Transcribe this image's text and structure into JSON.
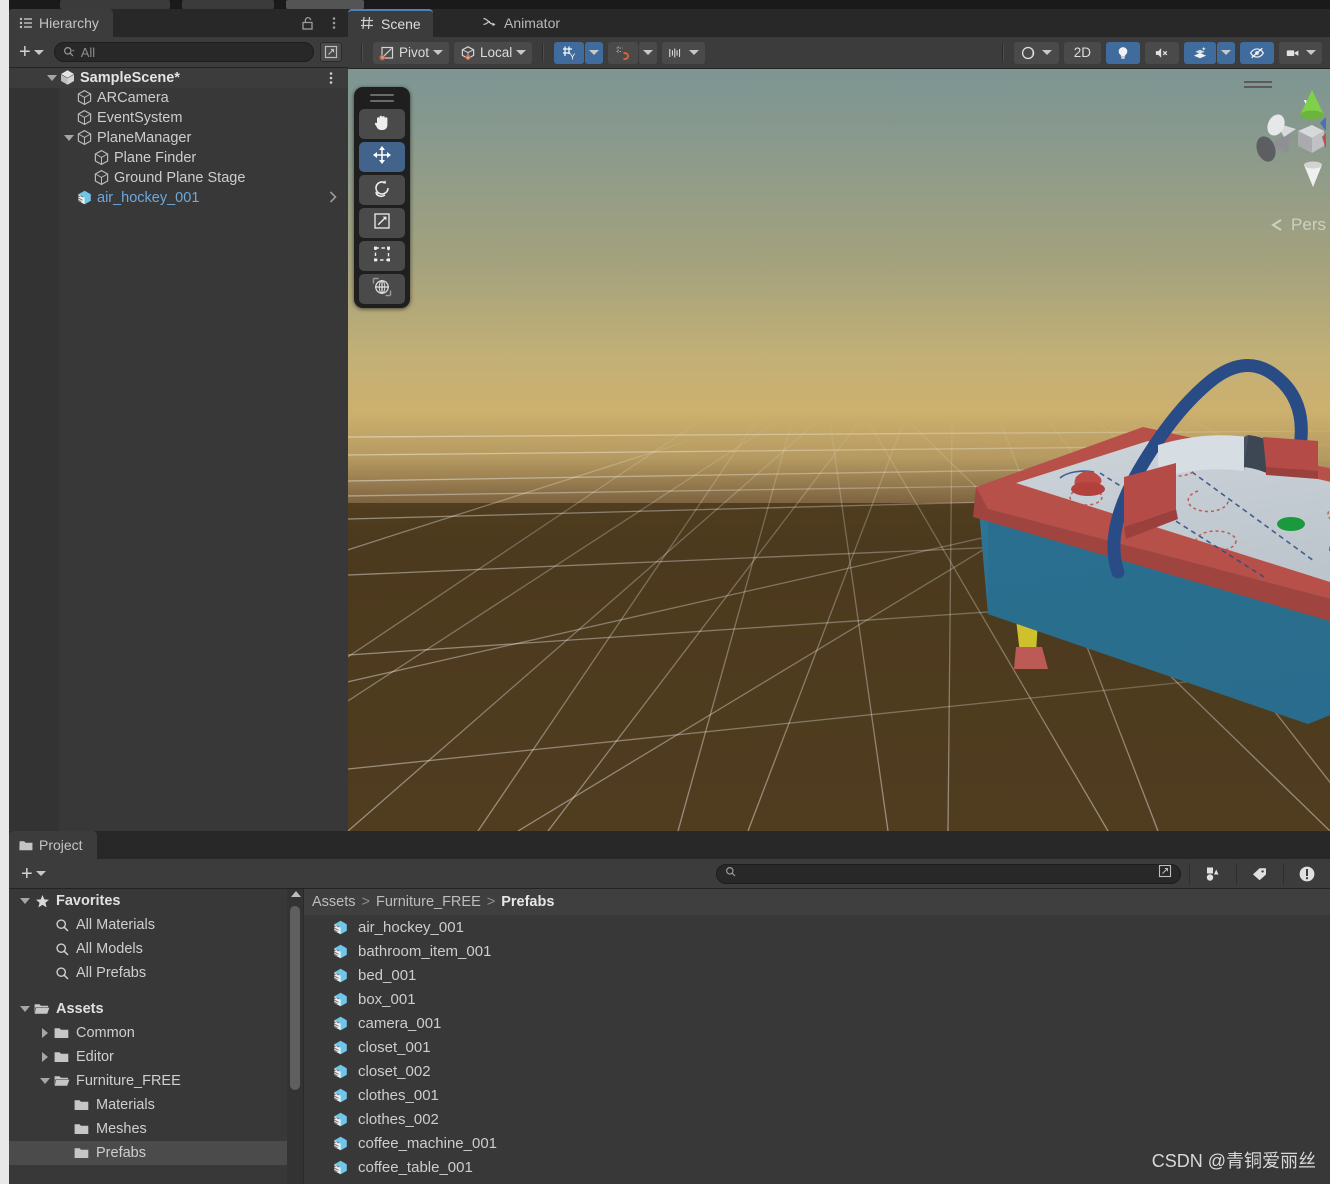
{
  "window": {
    "top_chips": [
      "",
      "",
      ""
    ]
  },
  "hierarchy": {
    "tab_label": "Hierarchy",
    "tab_icon": "hierarchy-list-icon",
    "lock_icon": "lock-open-icon",
    "menu_icon": "kebab-menu-icon",
    "add_label": "+",
    "search_placeholder": "All",
    "search_value": "",
    "search_icon": "search-icon",
    "expand_icon": "expand-window-icon",
    "rows": [
      {
        "label": "SampleScene*",
        "indent": 0,
        "icon": "unity-scene-icon",
        "expanded": true,
        "type": "scene",
        "kebab": true
      },
      {
        "label": "ARCamera",
        "indent": 1,
        "icon": "gameobject-cube-icon",
        "expanded": null,
        "type": "gameobject"
      },
      {
        "label": "EventSystem",
        "indent": 1,
        "icon": "gameobject-cube-icon",
        "expanded": null,
        "type": "gameobject"
      },
      {
        "label": "PlaneManager",
        "indent": 1,
        "icon": "gameobject-cube-icon",
        "expanded": true,
        "type": "gameobject"
      },
      {
        "label": "Plane Finder",
        "indent": 2,
        "icon": "gameobject-cube-icon",
        "expanded": null,
        "type": "gameobject"
      },
      {
        "label": "Ground Plane Stage",
        "indent": 2,
        "icon": "gameobject-cube-icon",
        "expanded": null,
        "type": "gameobject"
      },
      {
        "label": "air_hockey_001",
        "indent": 1,
        "icon": "prefab-icon",
        "expanded": null,
        "type": "prefab",
        "selected": true,
        "chevron": true
      }
    ]
  },
  "scene_panel": {
    "tabs": [
      {
        "label": "Scene",
        "icon": "scene-grid-icon",
        "active": true
      },
      {
        "label": "Animator",
        "icon": "animator-icon",
        "active": false
      }
    ],
    "toolbar": {
      "pivot_label": "Pivot",
      "pivot_icon": "pivot-icon",
      "handle_label": "Local",
      "handle_icon": "local-space-cube-icon",
      "grid_snap_icon": "grid-axis-y-icon",
      "grid_snap_on": true,
      "magnet_snap_icon": "magnet-snap-icon",
      "magnet_snap_on": false,
      "increment_snap_icon": "increment-snap-icon",
      "right": [
        {
          "name": "draw-mode-shaded-icon",
          "label": "",
          "on": false,
          "has_arrow": true
        },
        {
          "name": "2d-toggle",
          "label": "2D",
          "on": false,
          "has_arrow": false
        },
        {
          "name": "scene-lighting-icon",
          "label": "",
          "on": true,
          "has_arrow": false
        },
        {
          "name": "scene-audio-mute-icon",
          "label": "",
          "on": false,
          "has_arrow": false
        },
        {
          "name": "scene-fx-icon",
          "label": "",
          "on": true,
          "has_arrow": true
        },
        {
          "name": "scene-visibility-icon",
          "label": "",
          "on": true,
          "has_arrow": false
        },
        {
          "name": "scene-camera-icon",
          "label": "",
          "on": false,
          "has_arrow": true
        }
      ]
    },
    "tools_overlay": {
      "grip": "drag-handle",
      "buttons": [
        {
          "name": "hand-tool",
          "icon": "hand-icon",
          "active": false
        },
        {
          "name": "move-tool",
          "icon": "move-arrows-icon",
          "active": true
        },
        {
          "name": "rotate-tool",
          "icon": "rotate-icon",
          "active": false
        },
        {
          "name": "scale-tool",
          "icon": "scale-icon",
          "active": false
        },
        {
          "name": "rect-tool",
          "icon": "rect-transform-icon",
          "active": false
        },
        {
          "name": "transform-tool",
          "icon": "combined-transform-icon",
          "active": false
        }
      ]
    },
    "gizmo": {
      "axis_label": "y",
      "view_mode_label": "Pers",
      "collapse_icon": "gizmo-collapse-icon"
    },
    "scene_content": {
      "object": "air hockey table",
      "sky_top": "#7d9593",
      "sky_horizon": "#cdb06e",
      "ground": "#4e3c1e",
      "table_body": "#2d6f92",
      "table_rail": "#b24d47",
      "table_surface": "#c6ccd2",
      "table_legs": "#cfc02e",
      "table_feet": "#c05a55",
      "table_arch": "#2a4c86",
      "puck": "#1a9a3c"
    }
  },
  "project_panel": {
    "tab_label": "Project",
    "tab_icon": "folder-icon",
    "add_label": "+",
    "search_placeholder": "",
    "search_value": "",
    "search_icon": "search-icon",
    "expand_icon": "expand-window-icon",
    "right_buttons": [
      {
        "name": "asset-filter-icon"
      },
      {
        "name": "label-tag-icon"
      },
      {
        "name": "warning-icon"
      }
    ],
    "tree": [
      {
        "label": "Favorites",
        "indent": 0,
        "icon": "star-icon",
        "arrow": "down",
        "bold": true
      },
      {
        "label": "All Materials",
        "indent": 1,
        "icon": "search-icon",
        "arrow": "none"
      },
      {
        "label": "All Models",
        "indent": 1,
        "icon": "search-icon",
        "arrow": "none"
      },
      {
        "label": "All Prefabs",
        "indent": 1,
        "icon": "search-icon",
        "arrow": "none"
      },
      {
        "label": "",
        "indent": 0,
        "icon": "spacer",
        "arrow": "none"
      },
      {
        "label": "Assets",
        "indent": 0,
        "icon": "folder-open-icon",
        "arrow": "down",
        "bold": true
      },
      {
        "label": "Common",
        "indent": 1,
        "icon": "folder-icon",
        "arrow": "right"
      },
      {
        "label": "Editor",
        "indent": 1,
        "icon": "folder-icon",
        "arrow": "right"
      },
      {
        "label": "Furniture_FREE",
        "indent": 1,
        "icon": "folder-open-icon",
        "arrow": "down"
      },
      {
        "label": "Materials",
        "indent": 2,
        "icon": "folder-icon",
        "arrow": "none"
      },
      {
        "label": "Meshes",
        "indent": 2,
        "icon": "folder-icon",
        "arrow": "none"
      },
      {
        "label": "Prefabs",
        "indent": 2,
        "icon": "folder-icon",
        "arrow": "none",
        "selected": true
      }
    ],
    "breadcrumb": {
      "parts": [
        "Assets",
        "Furniture_FREE",
        "Prefabs"
      ],
      "separator": ">"
    },
    "assets": [
      {
        "label": "air_hockey_001",
        "icon": "prefab-icon"
      },
      {
        "label": "bathroom_item_001",
        "icon": "prefab-icon"
      },
      {
        "label": "bed_001",
        "icon": "prefab-icon"
      },
      {
        "label": "box_001",
        "icon": "prefab-icon"
      },
      {
        "label": "camera_001",
        "icon": "prefab-icon"
      },
      {
        "label": "closet_001",
        "icon": "prefab-icon"
      },
      {
        "label": "closet_002",
        "icon": "prefab-icon"
      },
      {
        "label": "clothes_001",
        "icon": "prefab-icon"
      },
      {
        "label": "clothes_002",
        "icon": "prefab-icon"
      },
      {
        "label": "coffee_machine_001",
        "icon": "prefab-icon"
      },
      {
        "label": "coffee_table_001",
        "icon": "prefab-icon"
      }
    ]
  },
  "watermark": {
    "text": "CSDN @青铜爱丽丝"
  }
}
